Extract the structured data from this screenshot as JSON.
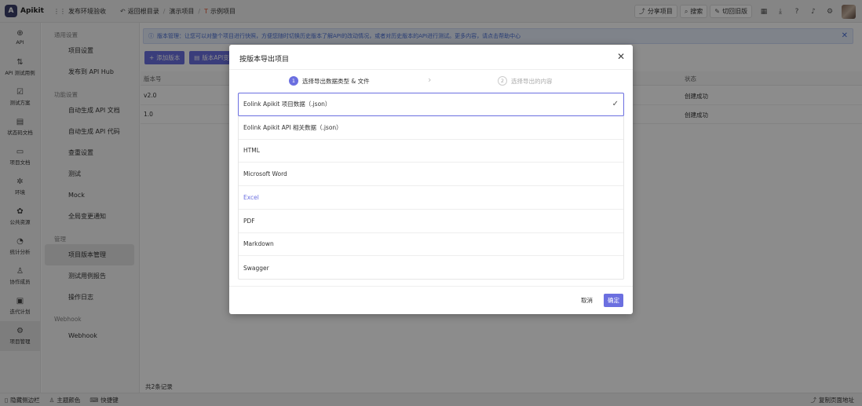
{
  "app": {
    "name": "Apikit",
    "logo_letter": "A"
  },
  "topbar": {
    "env": "发布环境验收",
    "back": "返回根目录",
    "breadcrumb": [
      "演示项目",
      "示例项目"
    ],
    "share": "分享项目",
    "search": "搜索",
    "switch_old": "切回旧版"
  },
  "rail": [
    {
      "label": "API",
      "icon": "api-icon"
    },
    {
      "label": "API 测试用例",
      "icon": "test-case-icon"
    },
    {
      "label": "测试方案",
      "icon": "test-plan-icon"
    },
    {
      "label": "状态码文档",
      "icon": "status-code-icon"
    },
    {
      "label": "项目文档",
      "icon": "project-doc-icon"
    },
    {
      "label": "环境",
      "icon": "environment-icon"
    },
    {
      "label": "公共资源",
      "icon": "public-resource-icon"
    },
    {
      "label": "统计分析",
      "icon": "statistics-icon"
    },
    {
      "label": "协作成员",
      "icon": "members-icon"
    },
    {
      "label": "迭代计划",
      "icon": "iteration-icon"
    },
    {
      "label": "项目管理",
      "icon": "project-manage-icon"
    }
  ],
  "subnav": {
    "group_general": "通用设置",
    "items_general": [
      "项目设置",
      "发布到 API Hub"
    ],
    "group_function": "功能设置",
    "items_function": [
      "自动生成 API 文档",
      "自动生成 API 代码",
      "查重设置",
      "测试",
      "Mock",
      "全局变更通知"
    ],
    "group_manage": "管理",
    "items_manage": [
      "项目版本管理",
      "测试用例报告",
      "操作日志"
    ],
    "group_webhook": "Webhook",
    "items_webhook": [
      "Webhook"
    ]
  },
  "main": {
    "notice": "版本管理：让您可以对整个项目进行快照，方便您随时切换历史版本了解API的改动情况，或者对历史版本的API进行测试。更多内容，请点击帮助中心",
    "add_version": "添加版本",
    "version_btn": "版本API变",
    "columns": {
      "version": "版本号",
      "status": "状态"
    },
    "rows": [
      {
        "version": "v2.0",
        "status": "创建成功"
      },
      {
        "version": "1.0",
        "status": "创建成功"
      }
    ],
    "total": "共2条记录"
  },
  "bottombar": {
    "hide_sidebar": "隐藏侧边栏",
    "theme": "主题颜色",
    "shortcut": "快捷键",
    "copy_url": "复制页面地址"
  },
  "modal": {
    "title": "按版本导出项目",
    "step1": {
      "num": "1",
      "label": "选择导出数据类型 & 文件"
    },
    "step2": {
      "num": "2",
      "label": "选择导出的内容"
    },
    "options": [
      "Eolink Apikit 项目数据（.json）",
      "Eolink Apikit API 相关数据（.json）",
      "HTML",
      "Microsoft Word",
      "Excel",
      "PDF",
      "Markdown",
      "Swagger"
    ],
    "selected_index": 0,
    "cancel": "取消",
    "confirm": "确定"
  },
  "colors": {
    "accent": "#6b6fe0",
    "notice_text": "#4a6fd4"
  }
}
